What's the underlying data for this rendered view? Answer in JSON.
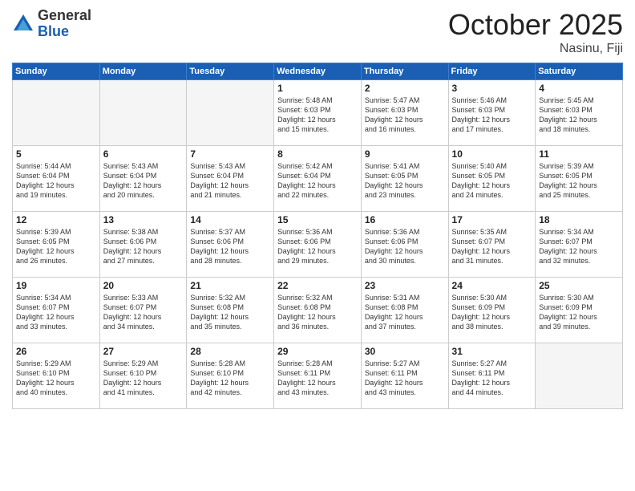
{
  "logo": {
    "general": "General",
    "blue": "Blue"
  },
  "title": "October 2025",
  "location": "Nasinu, Fiji",
  "days": [
    "Sunday",
    "Monday",
    "Tuesday",
    "Wednesday",
    "Thursday",
    "Friday",
    "Saturday"
  ],
  "weeks": [
    [
      {
        "day": "",
        "content": ""
      },
      {
        "day": "",
        "content": ""
      },
      {
        "day": "",
        "content": ""
      },
      {
        "day": "1",
        "content": "Sunrise: 5:48 AM\nSunset: 6:03 PM\nDaylight: 12 hours\nand 15 minutes."
      },
      {
        "day": "2",
        "content": "Sunrise: 5:47 AM\nSunset: 6:03 PM\nDaylight: 12 hours\nand 16 minutes."
      },
      {
        "day": "3",
        "content": "Sunrise: 5:46 AM\nSunset: 6:03 PM\nDaylight: 12 hours\nand 17 minutes."
      },
      {
        "day": "4",
        "content": "Sunrise: 5:45 AM\nSunset: 6:03 PM\nDaylight: 12 hours\nand 18 minutes."
      }
    ],
    [
      {
        "day": "5",
        "content": "Sunrise: 5:44 AM\nSunset: 6:04 PM\nDaylight: 12 hours\nand 19 minutes."
      },
      {
        "day": "6",
        "content": "Sunrise: 5:43 AM\nSunset: 6:04 PM\nDaylight: 12 hours\nand 20 minutes."
      },
      {
        "day": "7",
        "content": "Sunrise: 5:43 AM\nSunset: 6:04 PM\nDaylight: 12 hours\nand 21 minutes."
      },
      {
        "day": "8",
        "content": "Sunrise: 5:42 AM\nSunset: 6:04 PM\nDaylight: 12 hours\nand 22 minutes."
      },
      {
        "day": "9",
        "content": "Sunrise: 5:41 AM\nSunset: 6:05 PM\nDaylight: 12 hours\nand 23 minutes."
      },
      {
        "day": "10",
        "content": "Sunrise: 5:40 AM\nSunset: 6:05 PM\nDaylight: 12 hours\nand 24 minutes."
      },
      {
        "day": "11",
        "content": "Sunrise: 5:39 AM\nSunset: 6:05 PM\nDaylight: 12 hours\nand 25 minutes."
      }
    ],
    [
      {
        "day": "12",
        "content": "Sunrise: 5:39 AM\nSunset: 6:05 PM\nDaylight: 12 hours\nand 26 minutes."
      },
      {
        "day": "13",
        "content": "Sunrise: 5:38 AM\nSunset: 6:06 PM\nDaylight: 12 hours\nand 27 minutes."
      },
      {
        "day": "14",
        "content": "Sunrise: 5:37 AM\nSunset: 6:06 PM\nDaylight: 12 hours\nand 28 minutes."
      },
      {
        "day": "15",
        "content": "Sunrise: 5:36 AM\nSunset: 6:06 PM\nDaylight: 12 hours\nand 29 minutes."
      },
      {
        "day": "16",
        "content": "Sunrise: 5:36 AM\nSunset: 6:06 PM\nDaylight: 12 hours\nand 30 minutes."
      },
      {
        "day": "17",
        "content": "Sunrise: 5:35 AM\nSunset: 6:07 PM\nDaylight: 12 hours\nand 31 minutes."
      },
      {
        "day": "18",
        "content": "Sunrise: 5:34 AM\nSunset: 6:07 PM\nDaylight: 12 hours\nand 32 minutes."
      }
    ],
    [
      {
        "day": "19",
        "content": "Sunrise: 5:34 AM\nSunset: 6:07 PM\nDaylight: 12 hours\nand 33 minutes."
      },
      {
        "day": "20",
        "content": "Sunrise: 5:33 AM\nSunset: 6:07 PM\nDaylight: 12 hours\nand 34 minutes."
      },
      {
        "day": "21",
        "content": "Sunrise: 5:32 AM\nSunset: 6:08 PM\nDaylight: 12 hours\nand 35 minutes."
      },
      {
        "day": "22",
        "content": "Sunrise: 5:32 AM\nSunset: 6:08 PM\nDaylight: 12 hours\nand 36 minutes."
      },
      {
        "day": "23",
        "content": "Sunrise: 5:31 AM\nSunset: 6:08 PM\nDaylight: 12 hours\nand 37 minutes."
      },
      {
        "day": "24",
        "content": "Sunrise: 5:30 AM\nSunset: 6:09 PM\nDaylight: 12 hours\nand 38 minutes."
      },
      {
        "day": "25",
        "content": "Sunrise: 5:30 AM\nSunset: 6:09 PM\nDaylight: 12 hours\nand 39 minutes."
      }
    ],
    [
      {
        "day": "26",
        "content": "Sunrise: 5:29 AM\nSunset: 6:10 PM\nDaylight: 12 hours\nand 40 minutes."
      },
      {
        "day": "27",
        "content": "Sunrise: 5:29 AM\nSunset: 6:10 PM\nDaylight: 12 hours\nand 41 minutes."
      },
      {
        "day": "28",
        "content": "Sunrise: 5:28 AM\nSunset: 6:10 PM\nDaylight: 12 hours\nand 42 minutes."
      },
      {
        "day": "29",
        "content": "Sunrise: 5:28 AM\nSunset: 6:11 PM\nDaylight: 12 hours\nand 43 minutes."
      },
      {
        "day": "30",
        "content": "Sunrise: 5:27 AM\nSunset: 6:11 PM\nDaylight: 12 hours\nand 43 minutes."
      },
      {
        "day": "31",
        "content": "Sunrise: 5:27 AM\nSunset: 6:11 PM\nDaylight: 12 hours\nand 44 minutes."
      },
      {
        "day": "",
        "content": ""
      }
    ]
  ]
}
